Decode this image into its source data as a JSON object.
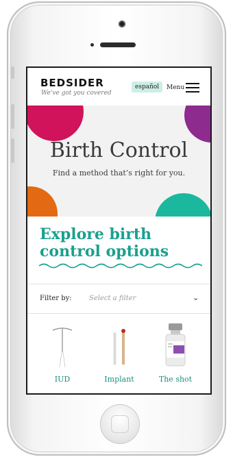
{
  "header": {
    "logo": "BEDSIDER",
    "tagline": "We've got you covered",
    "language_label": "español",
    "menu_label": "Menu"
  },
  "hero": {
    "title": "Birth Control",
    "subtitle": "Find a method that’s right for you."
  },
  "explore": {
    "title": "Explore birth control options"
  },
  "filter": {
    "label": "Filter by:",
    "placeholder": "Select a filter"
  },
  "methods": [
    {
      "label": "IUD",
      "icon": "iud-icon"
    },
    {
      "label": "Implant",
      "icon": "implant-icon"
    },
    {
      "label": "The shot",
      "icon": "shot-vial-icon"
    }
  ],
  "colors": {
    "accent": "#1aa08f",
    "magenta": "#d0135a",
    "purple": "#8e2b8f",
    "orange": "#e36a12",
    "teal": "#1bb89d",
    "language_badge": "#cdeee7"
  }
}
